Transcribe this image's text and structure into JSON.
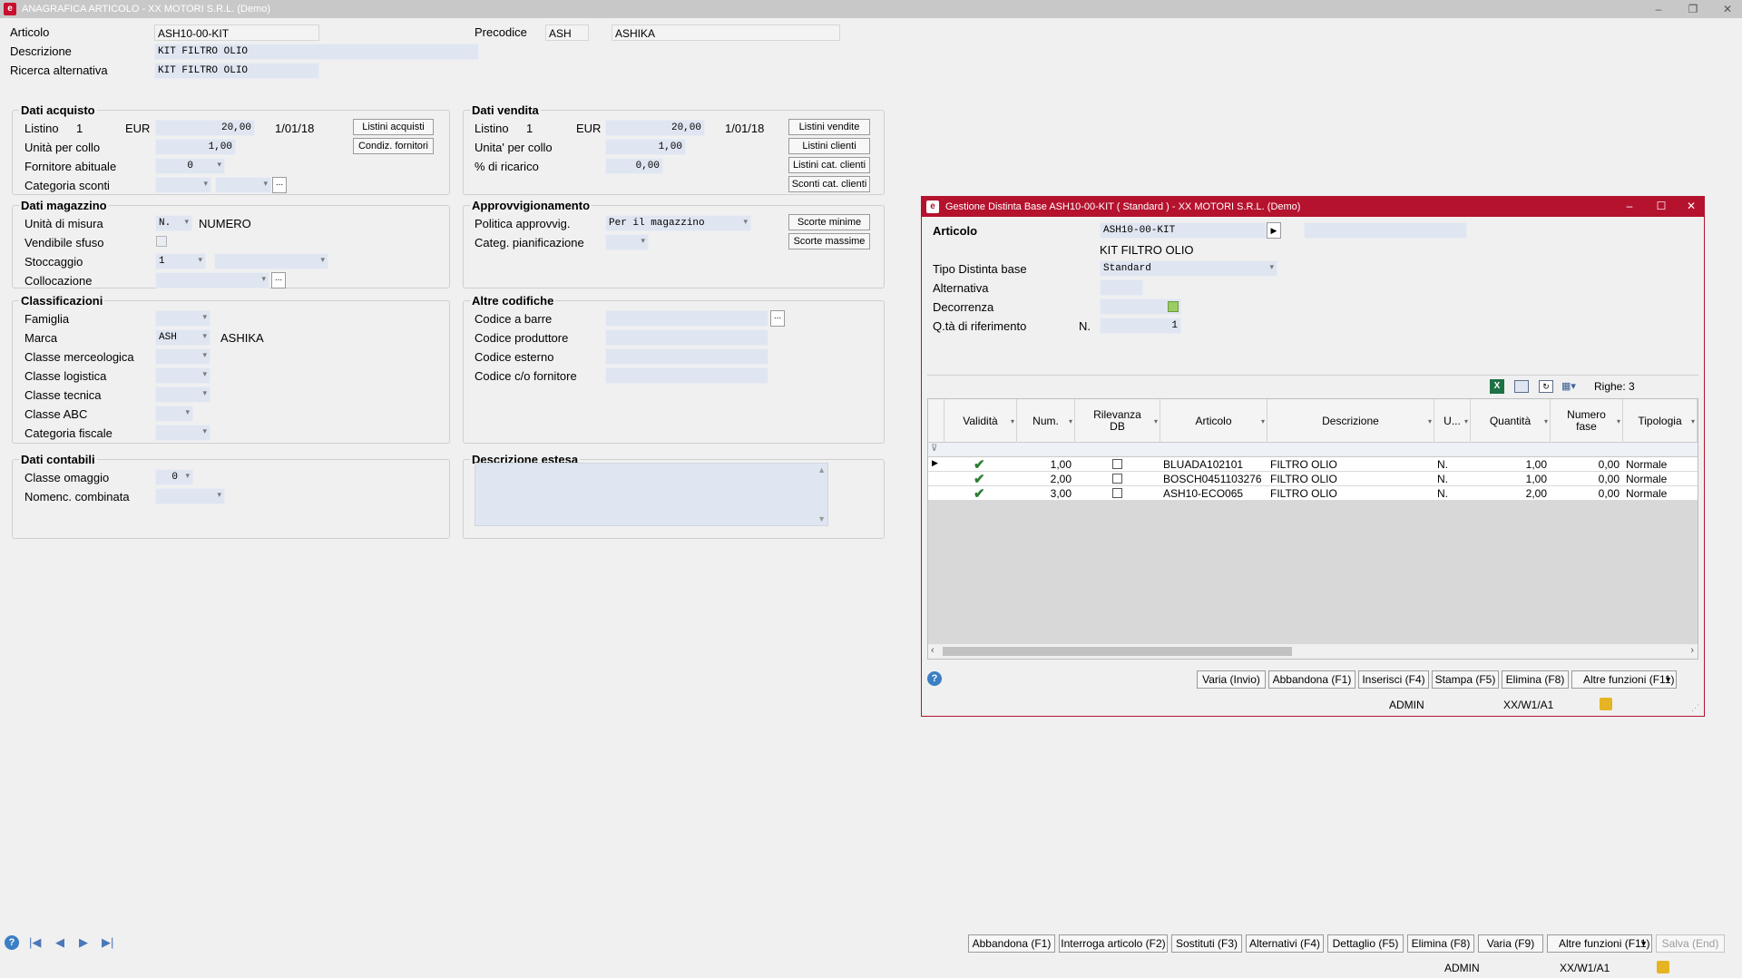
{
  "app": {
    "title": "ANAGRAFICA ARTICOLO - XX  MOTORI S.R.L.  (Demo)",
    "icon": "app-logo-icon"
  },
  "header": {
    "articolo_label": "Articolo",
    "articolo_value": "ASH10-00-KIT",
    "precodice_label": "Precodice",
    "precodice_code": "ASH",
    "precodice_desc": "ASHIKA",
    "descrizione_label": "Descrizione",
    "descrizione_value": "KIT FILTRO OLIO",
    "ricerca_label": "Ricerca alternativa",
    "ricerca_value": "KIT FILTRO OLIO"
  },
  "dati_acquisto": {
    "title": "Dati acquisto",
    "listino_label": "Listino",
    "listino_num": "1",
    "listino_cur": "EUR",
    "listino_value": "20,00",
    "listino_date": "1/01/18",
    "unita_collo_label": "Unità per collo",
    "unita_collo_value": "1,00",
    "fornitore_label": "Fornitore abituale",
    "fornitore_value": "0",
    "cat_sconti_label": "Categoria sconti",
    "btn_listini": "Listini acquisti",
    "btn_condiz": "Condiz. fornitori"
  },
  "dati_vendita": {
    "title": "Dati vendita",
    "listino_label": "Listino",
    "listino_num": "1",
    "listino_cur": "EUR",
    "listino_value": "20,00",
    "listino_date": "1/01/18",
    "unita_collo_label": "Unita' per collo",
    "unita_collo_value": "1,00",
    "ricarico_label": "% di ricarico",
    "ricarico_value": "0,00",
    "btn_listini_vendite": "Listini vendite",
    "btn_listini_clienti": "Listini clienti",
    "btn_listini_cat": "Listini cat. clienti",
    "btn_sconti_cat": "Sconti cat. clienti"
  },
  "dati_magazzino": {
    "title": "Dati magazzino",
    "um_label": "Unità di misura",
    "um_value": "N.",
    "um_desc": "NUMERO",
    "sfuso_label": "Vendibile sfuso",
    "stoccaggio_label": "Stoccaggio",
    "stoccaggio_value": "1",
    "collocazione_label": "Collocazione"
  },
  "approvvigionamento": {
    "title": "Approvvigionamento",
    "politica_label": "Politica approvvig.",
    "politica_value": "Per il magazzino",
    "categ_label": "Categ. pianificazione",
    "btn_scorte_min": "Scorte minime",
    "btn_scorte_max": "Scorte massime"
  },
  "classificazioni": {
    "title": "Classificazioni",
    "famiglia_label": "Famiglia",
    "marca_label": "Marca",
    "marca_value": "ASH",
    "marca_desc": "ASHIKA",
    "merceologica_label": "Classe merceologica",
    "logistica_label": "Classe logistica",
    "tecnica_label": "Classe tecnica",
    "abc_label": "Classe ABC",
    "fiscale_label": "Categoria fiscale"
  },
  "altre_codifiche": {
    "title": "Altre codifiche",
    "barre_label": "Codice a barre",
    "produttore_label": "Codice produttore",
    "esterno_label": "Codice esterno",
    "fornitore_label": "Codice c/o fornitore"
  },
  "dati_contabili": {
    "title": "Dati contabili",
    "omaggio_label": "Classe omaggio",
    "omaggio_value": "0",
    "nomenc_label": "Nomenc. combinata"
  },
  "descrizione_estesa": {
    "title": "Descrizione estesa"
  },
  "footer": {
    "buttons": [
      "Abbandona (F1)",
      "Interroga articolo (F2)",
      "Sostituti (F3)",
      "Alternativi (F4)",
      "Dettaglio (F5)",
      "Elimina (F8)",
      "Varia (F9)",
      "Altre funzioni (F11)",
      "Salva (End)"
    ],
    "user": "ADMIN",
    "path": "XX/W1/A1"
  },
  "dialog": {
    "title": "Gestione Distinta Base  ASH10-00-KIT ( Standard ) - XX  MOTORI S.R.L.  (Demo)",
    "articolo_label": "Articolo",
    "articolo_value": "ASH10-00-KIT",
    "articolo_desc": "KIT FILTRO OLIO",
    "tipo_label": "Tipo Distinta base",
    "tipo_value": "Standard",
    "alternativa_label": "Alternativa",
    "decorrenza_label": "Decorrenza",
    "qta_label": "Q.tà di riferimento",
    "qta_um": "N.",
    "qta_value": "1",
    "righe": "Righe: 3",
    "columns": [
      "Validità",
      "Num.",
      "Rilevanza DB",
      "Articolo",
      "Descrizione",
      "U...",
      "Quantità",
      "Numero fase",
      "Tipologia"
    ],
    "rows": [
      {
        "num": "1,00",
        "articolo": "BLUADA102101",
        "descrizione": "FILTRO OLIO",
        "um": "N.",
        "quantita": "1,00",
        "fase": "0,00",
        "tipologia": "Normale"
      },
      {
        "num": "2,00",
        "articolo": "BOSCH0451103276",
        "descrizione": "FILTRO OLIO",
        "um": "N.",
        "quantita": "1,00",
        "fase": "0,00",
        "tipologia": "Normale"
      },
      {
        "num": "3,00",
        "articolo": "ASH10-ECO065",
        "descrizione": "FILTRO OLIO",
        "um": "N.",
        "quantita": "2,00",
        "fase": "0,00",
        "tipologia": "Normale"
      }
    ],
    "buttons": [
      "Varia (Invio)",
      "Abbandona (F1)",
      "Inserisci (F4)",
      "Stampa (F5)",
      "Elimina (F8)",
      "Altre funzioni (F11)"
    ],
    "user": "ADMIN",
    "path": "XX/W1/A1"
  }
}
